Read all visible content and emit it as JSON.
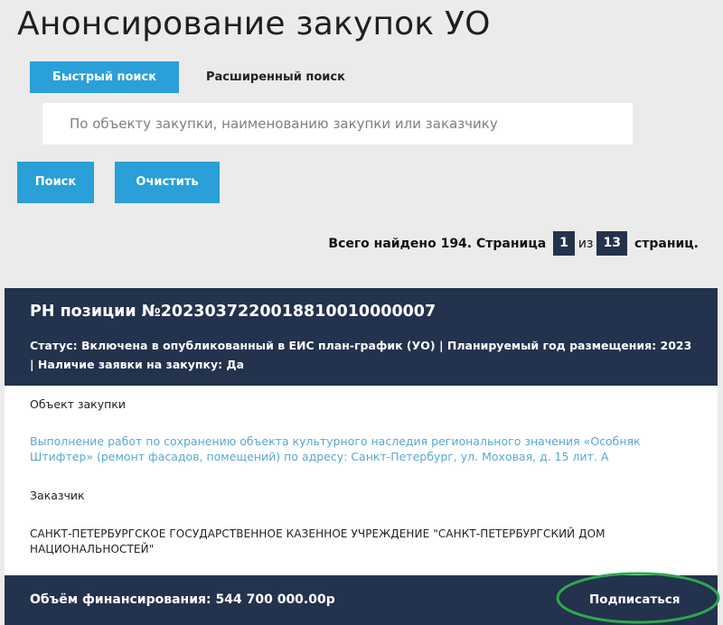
{
  "page": {
    "title": "Анонсирование закупок УО"
  },
  "tabs": [
    {
      "label": "Быстрый поиск",
      "active": true
    },
    {
      "label": "Расширенный поиск",
      "active": false
    }
  ],
  "search": {
    "placeholder": "По объекту закупки, наименованию закупки или заказчику",
    "value": ""
  },
  "actions": {
    "search_label": "Поиск",
    "clear_label": "Очистить"
  },
  "pager": {
    "prefix": "Всего найдено 194. Страница",
    "current_page": "1",
    "of_label": "из",
    "total_pages": "13",
    "suffix": "страниц."
  },
  "result": {
    "number": "РН позиции №2023037220018810010000007",
    "status": "Статус: Включена в опубликованный в ЕИС план-график (УО) | Планируемый год размещения: 2023 | Наличие заявки на закупку: Да",
    "object_label": "Объект закупки",
    "object_value": "Выполнение работ по сохранению объекта культурного наследия регионального значения «Особняк Штифтер» (ремонт фасадов, помещений) по адресу: Санкт-Петербург, ул. Моховая, д. 15 лит. А",
    "customer_label": "Заказчик",
    "customer_value": "САНКТ-ПЕТЕРБУРГСКОЕ ГОСУДАРСТВЕННОЕ КАЗЕННОЕ УЧРЕЖДЕНИЕ \"САНКТ-ПЕТЕРБУРГСКИЙ ДОМ НАЦИОНАЛЬНОСТЕЙ\"",
    "funding": "Объём финансирования: 544 700 000.00р",
    "subscribe_label": "Подписаться"
  },
  "colors": {
    "accent": "#2a9fd8",
    "dark": "#23324d",
    "link": "#5aa7d3",
    "highlight_ring": "#2fa84f"
  }
}
